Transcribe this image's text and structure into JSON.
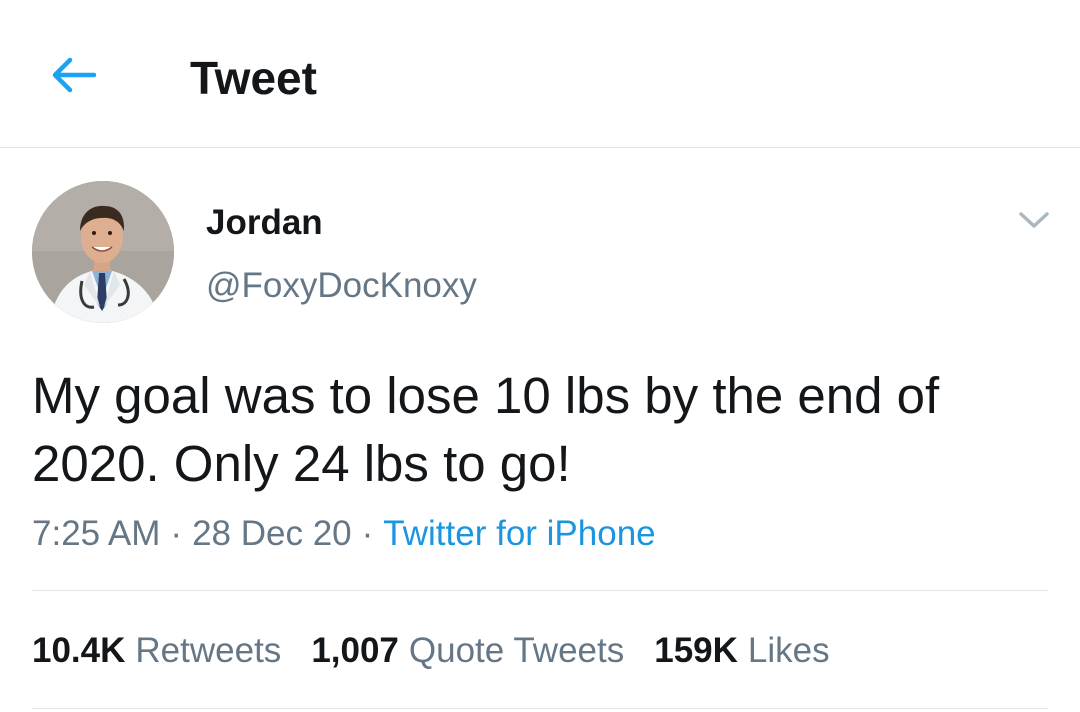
{
  "header": {
    "title": "Tweet",
    "back_icon": "arrow-left-icon",
    "accent_color": "#1da1f2"
  },
  "user": {
    "display_name": "Jordan",
    "handle": "@FoxyDocKnoxy",
    "avatar": "profile-photo-doctor"
  },
  "tweet": {
    "text": "My goal was to lose 10 lbs by the end of 2020. Only 24 lbs to go!",
    "time": "7:25 AM",
    "date": "28 Dec 20",
    "source": "Twitter for iPhone",
    "separator": "·"
  },
  "stats": {
    "retweets_count": "10.4K",
    "retweets_label": "Retweets",
    "quotes_count": "1,007",
    "quotes_label": "Quote Tweets",
    "likes_count": "159K",
    "likes_label": "Likes"
  }
}
